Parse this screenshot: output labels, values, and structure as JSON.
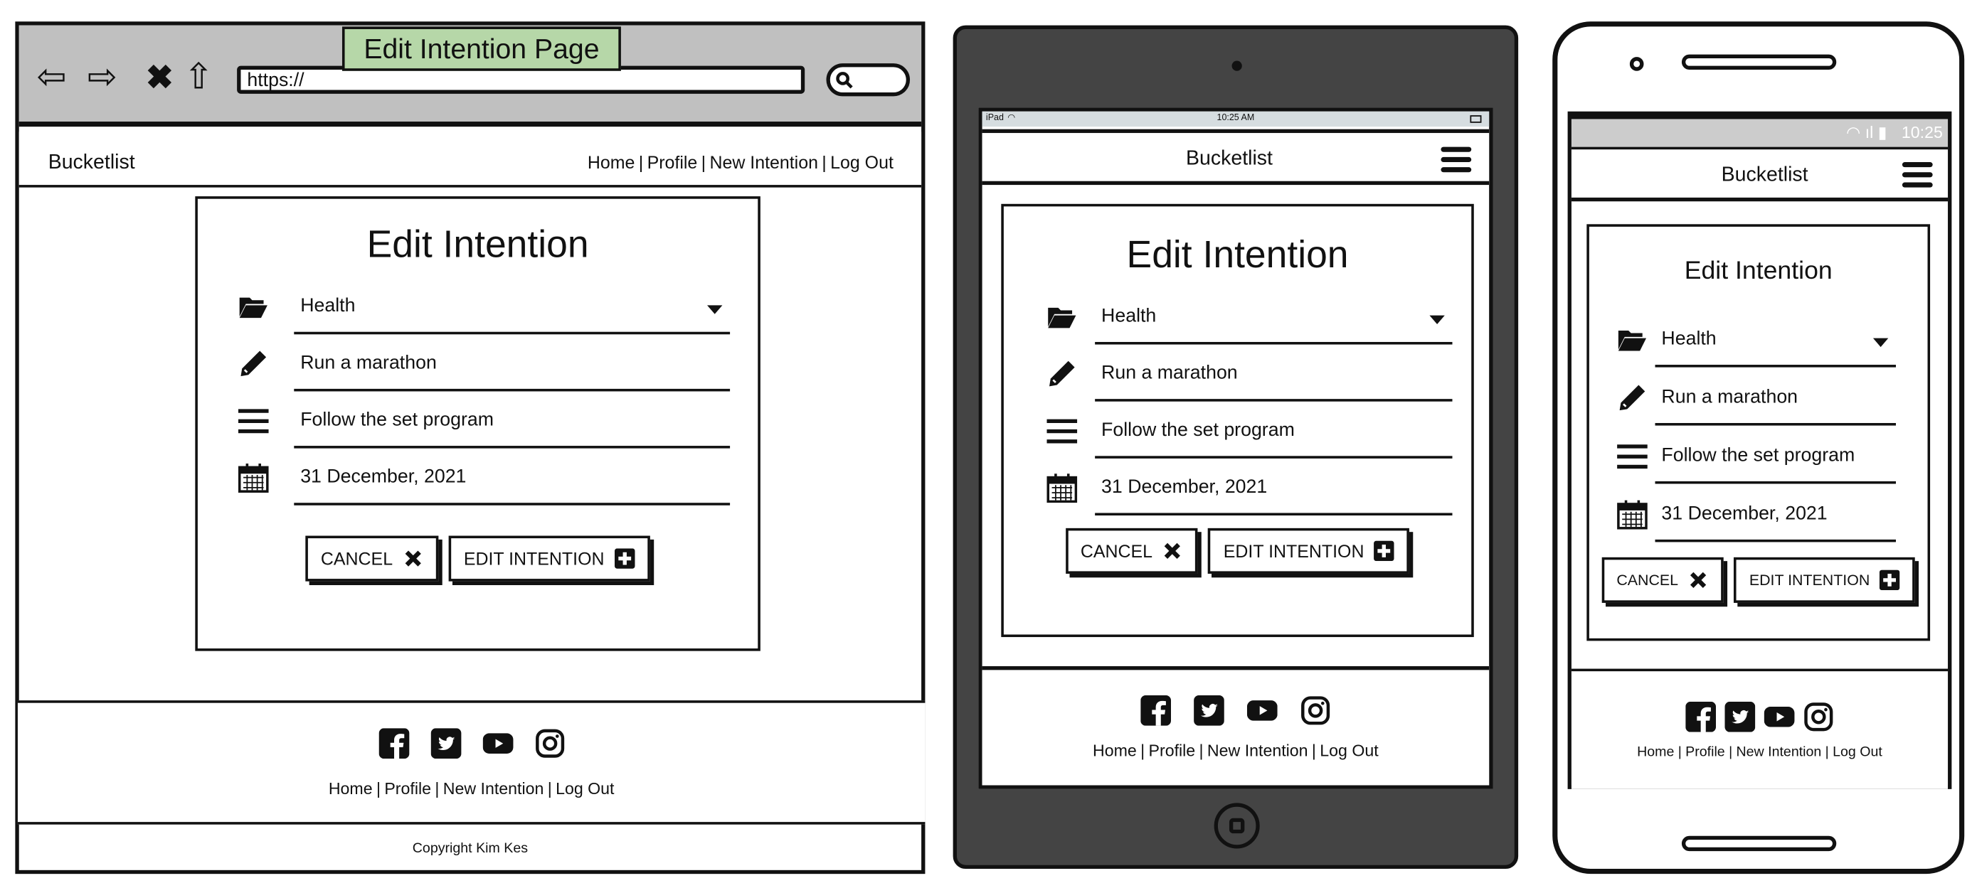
{
  "annotation": "Edit Intention Page",
  "browser": {
    "url": "https://"
  },
  "tablet_status": {
    "device": "iPad",
    "time": "10:25 AM"
  },
  "phone_status": {
    "time": "10:25"
  },
  "brand": "Bucketlist",
  "nav": {
    "separator": "|",
    "items": [
      "Home",
      "Profile",
      "New Intention",
      "Log Out"
    ]
  },
  "form": {
    "title": "Edit Intention",
    "category": "Health",
    "intention_title": "Run a marathon",
    "description": "Follow the set program",
    "date": "31 December, 2021",
    "cancel_label": "CANCEL",
    "submit_label": "EDIT INTENTION"
  },
  "social_icons": [
    "facebook-icon",
    "twitter-icon",
    "youtube-icon",
    "instagram-icon"
  ],
  "copyright": "Copyright Kim Kes",
  "colors": {
    "annotation_bg": "#b6d7a8",
    "browser_chrome": "#c0c0c0",
    "tablet_body": "#444444"
  }
}
